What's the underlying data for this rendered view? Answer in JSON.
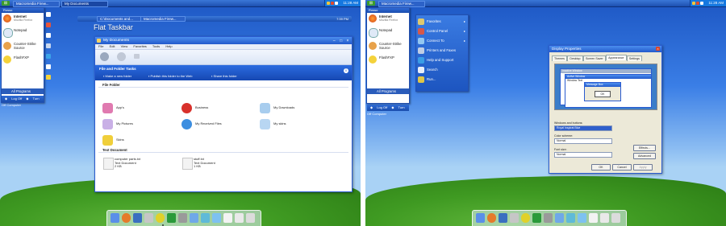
{
  "left": {
    "taskbar": {
      "tasks": [
        "Macromedia Firew...",
        "My Documents"
      ],
      "clock": "11:28 AM"
    },
    "start_menu": {
      "header": "Rosso",
      "items": [
        {
          "label": "Internet",
          "sub": "Mozilla Firefox"
        },
        {
          "label": "Notepad",
          "sub": ""
        },
        {
          "label": "Counter-Strike Source",
          "sub": ""
        },
        {
          "label": "FlashFXP",
          "sub": ""
        }
      ],
      "all_programs": "All Programs",
      "log_off": "Log Off",
      "turn_off": "Turn Off Computer"
    },
    "subtaskbar": {
      "tasks": [
        "C:\\Documents and...",
        "Macromedia Firew..."
      ],
      "clock": "7:39 PM"
    },
    "flat_label": "Flat Taskbar",
    "explorer": {
      "title": "My Documents",
      "menu": [
        "File",
        "Edit",
        "View",
        "Favorites",
        "Tools",
        "Help"
      ],
      "tasks_header": "File and Folder Tasks",
      "task_links": [
        "Make a new folder",
        "Publish this folder to the Web",
        "Share this folder"
      ],
      "section_folder": "File Folder",
      "folders": [
        "App's",
        "Business",
        "My Downloads",
        "My Pictures",
        "My Received Files",
        "My skins",
        "Skins"
      ],
      "section_text": "Text Document",
      "docs": [
        {
          "name": "computer parts.txt",
          "type": "Text Document",
          "size": "2 KB"
        },
        {
          "name": "stuff.txt",
          "type": "Text Document",
          "size": "1 KB"
        }
      ]
    }
  },
  "right": {
    "taskbar": {
      "tasks": [
        "Macromedia Firew..."
      ],
      "clock": "11:28 AM"
    },
    "start_menu": {
      "header": "Rosso",
      "items": [
        {
          "label": "Internet",
          "sub": "Mozilla Firefox"
        },
        {
          "label": "Notepad",
          "sub": ""
        },
        {
          "label": "Counter-Strike Source",
          "sub": ""
        },
        {
          "label": "FlashFXP",
          "sub": ""
        }
      ],
      "all_programs": "All Programs",
      "log_off": "Log Off",
      "turn_off": "Turn Off Computer"
    },
    "places": [
      {
        "label": "Favorites",
        "arrow": "▸"
      },
      {
        "label": "Control Panel",
        "arrow": "▸"
      },
      {
        "label": "Connect To",
        "arrow": "▸"
      },
      {
        "label": "Printers and Faxes",
        "arrow": ""
      },
      {
        "label": "Help and Support",
        "arrow": ""
      },
      {
        "label": "Search",
        "arrow": ""
      },
      {
        "label": "Run...",
        "arrow": ""
      }
    ],
    "dialog": {
      "title": "Display Properties",
      "tabs": [
        "Themes",
        "Desktop",
        "Screen Saver",
        "Appearance",
        "Settings"
      ],
      "inactive_window": "Inactive Window",
      "active_window": "Active Window",
      "window_text": "Window Text",
      "message_box": "Message Box",
      "ok_preview": "OK",
      "windows_buttons_label": "Windows and buttons:",
      "windows_buttons_value": "Royal Inspirat Blue",
      "color_scheme_label": "Color scheme:",
      "color_scheme_value": "Normal",
      "font_size_label": "Font size:",
      "font_size_value": "Normal",
      "effects": "Effects...",
      "advanced": "Advanced",
      "ok": "OK",
      "cancel": "Cancel",
      "apply": "Apply"
    }
  },
  "colors": {
    "xp_blue": "#2259cb",
    "bliss_green": "#3f9a22",
    "start_green": "#3c9c2c"
  }
}
